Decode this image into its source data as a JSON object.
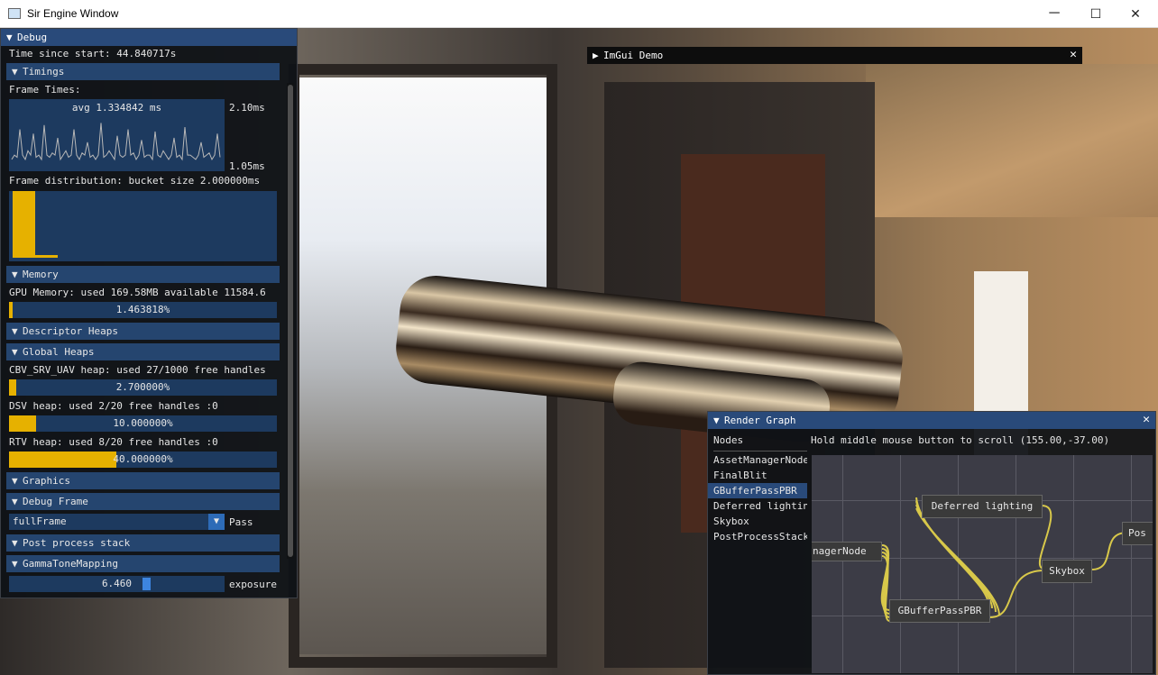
{
  "window": {
    "title": "Sir Engine Window",
    "min": "─",
    "max": "☐",
    "close": "✕"
  },
  "debug": {
    "title": "Debug",
    "time_since_start": "Time since start: 44.840717s",
    "timings": {
      "header": "Timings",
      "frame_times_label": "Frame Times:",
      "avg": "avg 1.334842 ms",
      "max_label": "2.10ms",
      "min_label": "1.05ms",
      "distribution_label": "Frame distribution: bucket size 2.000000ms"
    },
    "memory": {
      "header": "Memory",
      "gpu": "GPU Memory: used 169.58MB available 11584.6",
      "percent_text": "1.463818%",
      "percent": 1.463818
    },
    "descriptor_heaps": {
      "header": "Descriptor Heaps"
    },
    "global_heaps": {
      "header": "Global Heaps",
      "cbv": {
        "label": "CBV_SRV_UAV heap: used 27/1000 free handles",
        "text": "2.700000%",
        "percent": 2.7
      },
      "dsv": {
        "label": "DSV heap: used 2/20 free handles :0",
        "text": "10.000000%",
        "percent": 10
      },
      "rtv": {
        "label": "RTV heap: used 8/20 free handles :0",
        "text": "40.000000%",
        "percent": 40
      }
    },
    "graphics": {
      "header": "Graphics"
    },
    "debug_frame": {
      "header": "Debug Frame",
      "value": "fullFrame",
      "label": "Pass"
    },
    "post_process": {
      "header": "Post process stack"
    },
    "gamma": {
      "header": "GammaToneMapping",
      "value": "6.460",
      "label": "exposure"
    }
  },
  "imgui_demo": {
    "title": "ImGui Demo"
  },
  "render_graph": {
    "title": "Render Graph",
    "nodes_header": "Nodes",
    "nodes": [
      "AssetManagerNode",
      "FinalBlit",
      "GBufferPassPBR",
      "Deferred lighting",
      "Skybox",
      "PostProcessStack"
    ],
    "selected": "GBufferPassPBR",
    "hint": "Hold middle mouse button to scroll (155.00,-37.00)",
    "graph_nodes": {
      "asset": "nagerNode",
      "gbuffer": "GBufferPassPBR",
      "deferred": "Deferred lighting",
      "skybox": "Skybox",
      "post": "Pos"
    }
  },
  "frame_times": [
    1.2,
    1.3,
    1.25,
    1.9,
    1.3,
    1.2,
    1.4,
    1.3,
    1.8,
    1.25,
    1.3,
    1.2,
    2.0,
    1.3,
    1.25,
    1.35,
    1.3,
    1.7,
    1.2,
    1.3,
    1.4,
    1.25,
    1.3,
    1.9,
    1.3,
    1.2,
    1.35,
    1.3,
    1.6,
    1.25,
    1.3,
    1.2,
    1.3,
    2.05,
    1.25,
    1.3,
    1.4,
    1.3,
    1.2,
    1.75,
    1.3,
    1.25,
    1.3,
    1.9,
    1.3,
    1.35,
    1.2,
    1.3,
    1.65,
    1.25,
    1.3,
    1.3,
    1.2,
    1.85,
    1.3,
    1.25,
    1.4,
    1.3,
    1.2,
    1.3,
    1.7,
    1.25,
    1.3,
    1.2,
    1.95,
    1.3,
    1.3,
    1.25,
    1.2,
    1.3,
    1.6,
    1.25,
    1.3,
    1.35,
    1.2,
    1.3,
    1.8,
    1.25
  ],
  "distribution": [
    1.0,
    0.04
  ],
  "colors": {
    "accent": "#e6b100",
    "header": "#25456f",
    "title_active": "#294a7a",
    "link": "#d8c84a"
  }
}
